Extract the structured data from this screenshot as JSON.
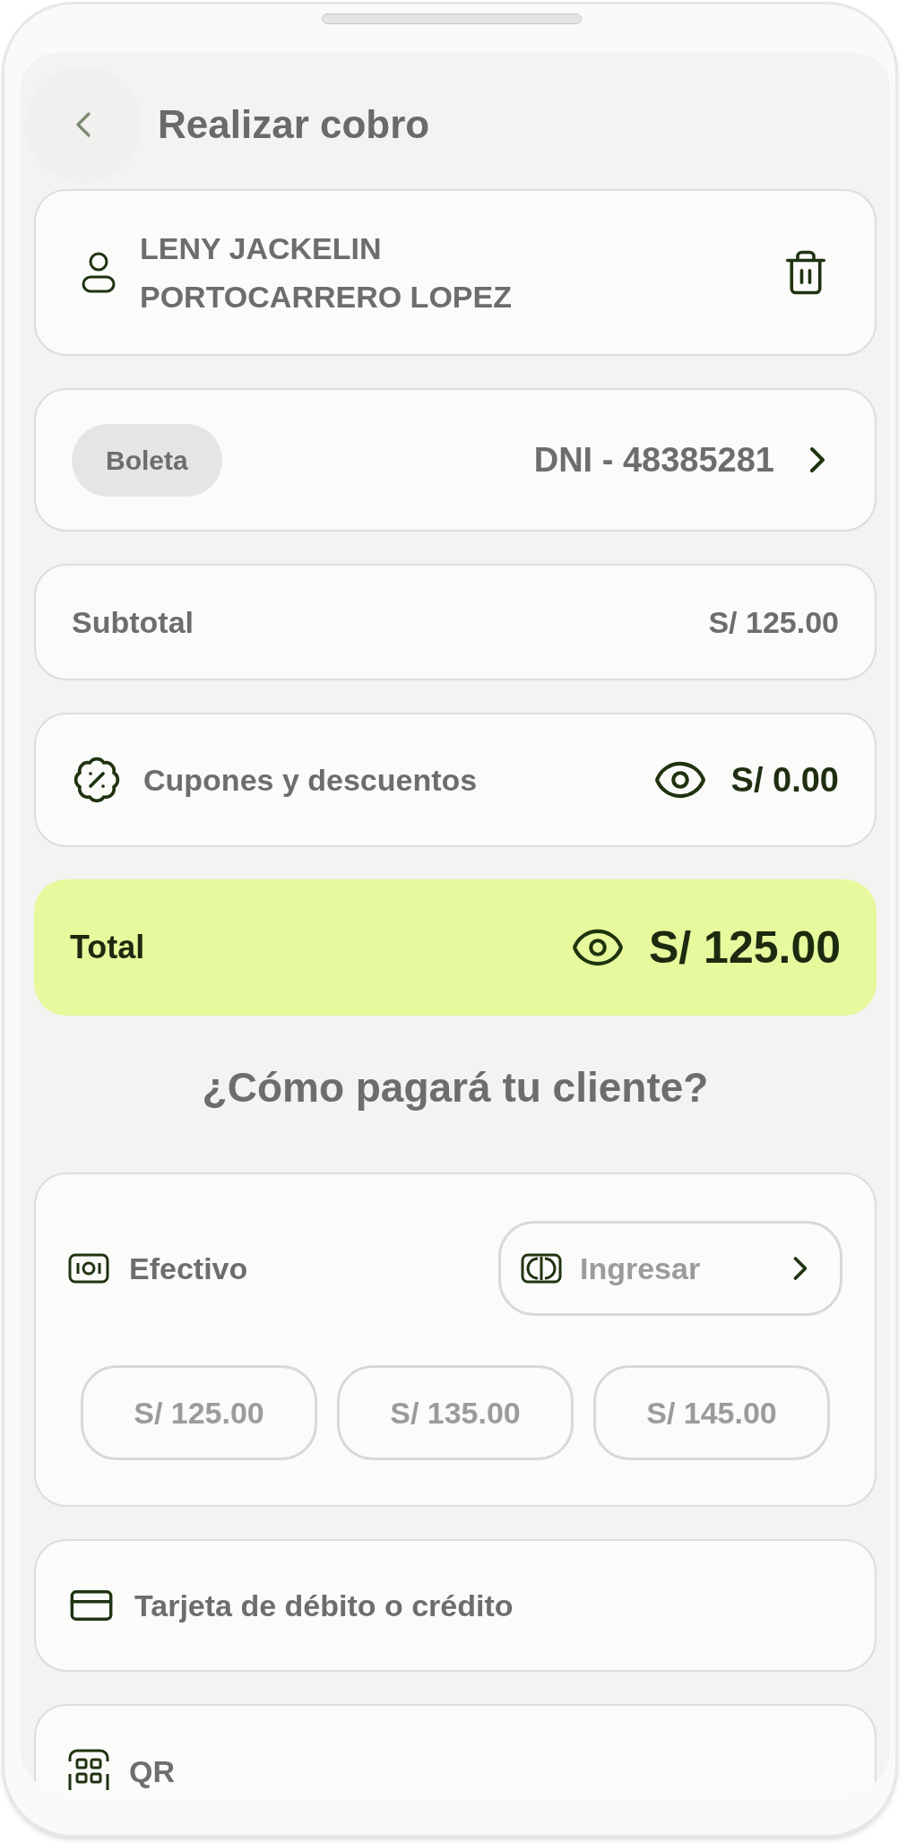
{
  "header": {
    "title": "Realizar cobro"
  },
  "customer": {
    "name_lines": [
      "LENY JACKELIN",
      "PORTOCARRERO LOPEZ"
    ]
  },
  "document": {
    "type": "Boleta",
    "id": "DNI - 48385281"
  },
  "subtotal": {
    "label": "Subtotal",
    "amount": "S/ 125.00"
  },
  "discounts": {
    "label": "Cupones y descuentos",
    "amount": "S/ 0.00"
  },
  "total": {
    "label": "Total",
    "amount": "S/ 125.00"
  },
  "question": "¿Cómo pagará tu cliente?",
  "payment_methods": [
    {
      "kind": "cash",
      "label": "Efectivo",
      "input_label": "Ingresar",
      "quick_amounts": [
        "S/ 125.00",
        "S/ 135.00",
        "S/ 145.00"
      ]
    },
    {
      "kind": "card",
      "label": "Tarjeta de débito o crédito"
    },
    {
      "kind": "qr",
      "label": "QR"
    }
  ]
}
